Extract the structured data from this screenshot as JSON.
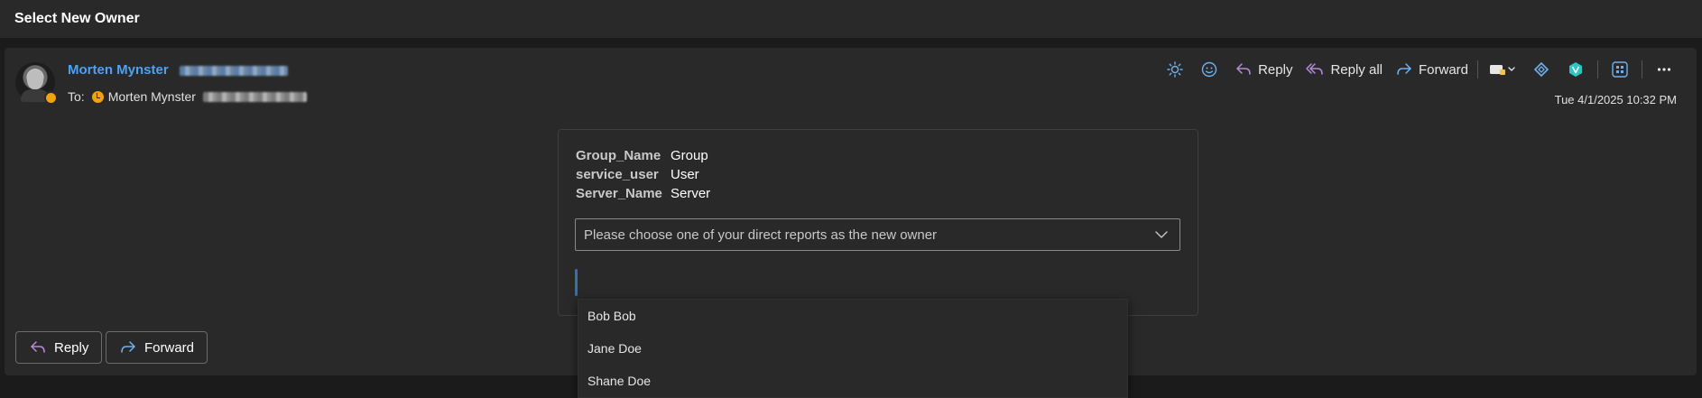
{
  "window": {
    "title": "Select New Owner"
  },
  "message": {
    "sender_name": "Morten Mynster",
    "to_label": "To:",
    "recipient_name": "Morten Mynster",
    "timestamp": "Tue 4/1/2025 10:32 PM"
  },
  "toolbar": {
    "reply_label": "Reply",
    "reply_all_label": "Reply all",
    "forward_label": "Forward",
    "icons": [
      "brightness-icon",
      "emoji-icon",
      "reply-icon",
      "reply-all-icon",
      "forward-icon",
      "tag-icon",
      "chevron-down-icon",
      "diamond-addin-icon",
      "viva-addin-icon",
      "apps-icon",
      "more-icon"
    ]
  },
  "card": {
    "facts": [
      {
        "key": "Group_Name",
        "value": "Group"
      },
      {
        "key": "service_user",
        "value": "User"
      },
      {
        "key": "Server_Name",
        "value": "Server"
      }
    ],
    "select_placeholder": "Please choose one of your direct reports as the new owner",
    "options": [
      "Bob Bob",
      "Jane Doe",
      "Shane Doe"
    ]
  },
  "footer": {
    "reply_label": "Reply",
    "forward_label": "Forward"
  },
  "colors": {
    "accent": "#4ea1f3",
    "reply_arrow": "#b58ad6",
    "forward_arrow": "#6fb1f0",
    "presence_away": "#f2a20c",
    "viva": "#2ec5c5"
  }
}
